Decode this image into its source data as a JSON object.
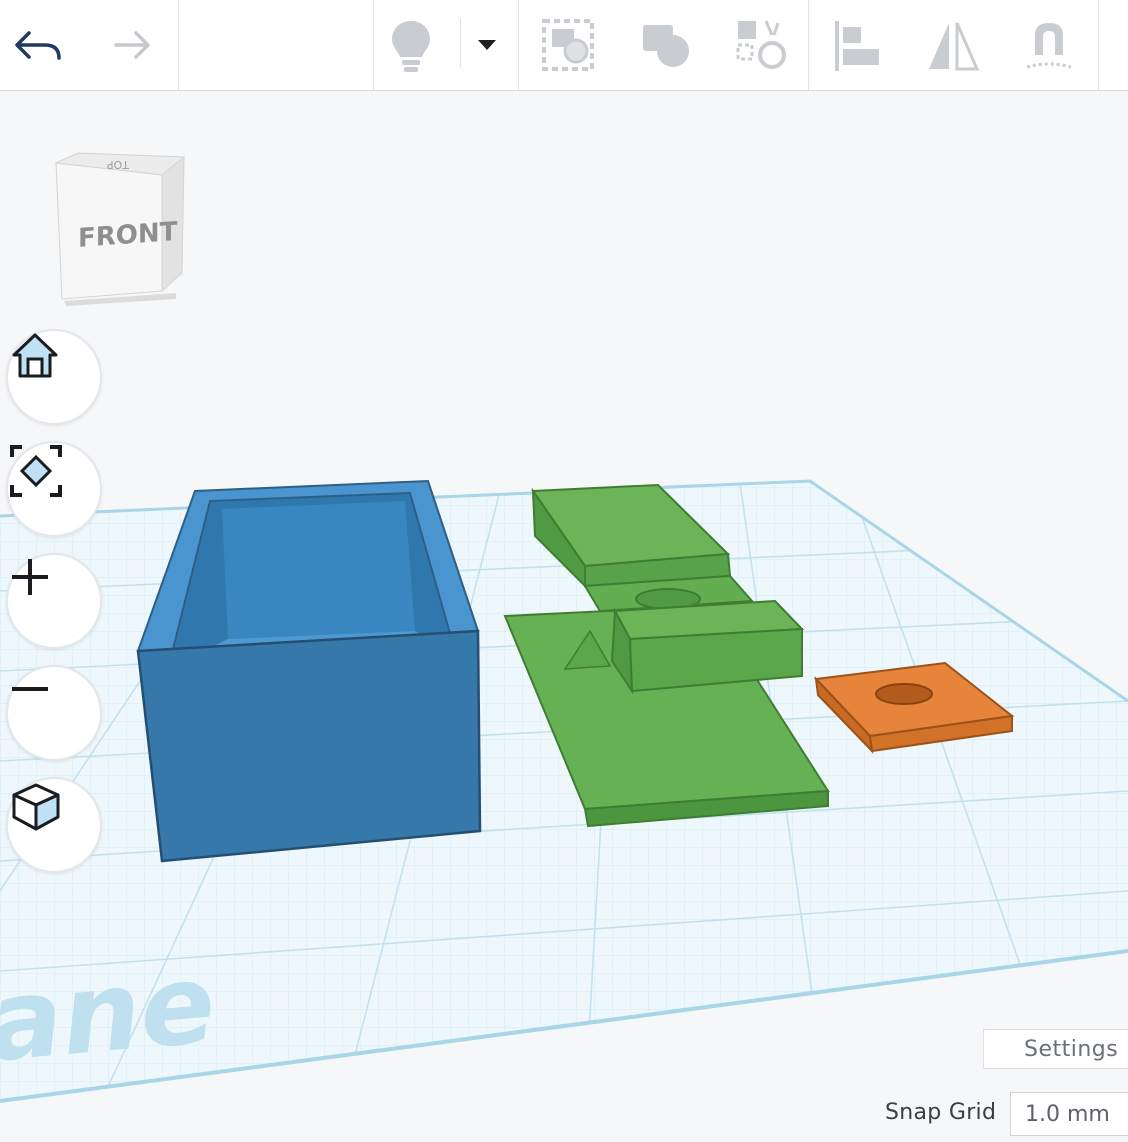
{
  "toolbar": {
    "buttons": [
      {
        "name": "undo-icon"
      },
      {
        "name": "redo-icon"
      },
      {
        "name": "lightbulb-icon"
      },
      {
        "name": "dropdown-caret-icon"
      },
      {
        "name": "group-icon"
      },
      {
        "name": "ungroup-icon"
      },
      {
        "name": "solid-hole-icon"
      },
      {
        "name": "align-icon"
      },
      {
        "name": "mirror-icon"
      },
      {
        "name": "magnet-icon"
      }
    ]
  },
  "viewcube": {
    "face_front": "FRONT",
    "face_top": "TOP"
  },
  "workplane": {
    "label": "ane",
    "grid_color": "#bfe3f0"
  },
  "nav": [
    "home-icon",
    "fit-view-icon",
    "zoom-in-icon",
    "zoom-out-icon",
    "perspective-icon"
  ],
  "footer": {
    "settings": "Settings",
    "snap_label": "Snap Grid",
    "snap_value": "1.0 mm"
  },
  "colors": {
    "blue_box": "#3a82bf",
    "green": "#5fad4e",
    "orange": "#e07c32",
    "accent": "#1e3a5f"
  }
}
